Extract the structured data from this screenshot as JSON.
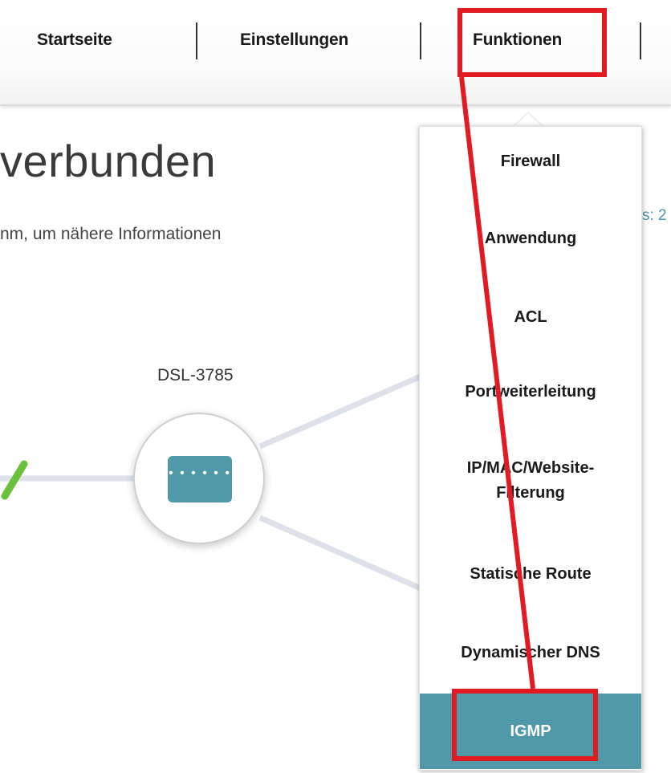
{
  "nav": {
    "items": [
      "Startseite",
      "Einstellungen",
      "Funktionen"
    ]
  },
  "page": {
    "title": "verbunden",
    "subtitle": "nm, um nähere Informationen",
    "status_snippet": "s: 2",
    "device_name": "DSL-3785"
  },
  "dropdown": {
    "items": [
      "Firewall",
      "Anwendung",
      "ACL",
      "Portweiterleitung",
      "IP/MAC/Website-Filterung",
      "Statische Route",
      "Dynamischer DNS",
      "IGMP"
    ],
    "active_item": "IGMP"
  },
  "colors": {
    "accent": "#4f99a8",
    "annotation": "#e21b23",
    "status_ok": "#6cc13b"
  }
}
